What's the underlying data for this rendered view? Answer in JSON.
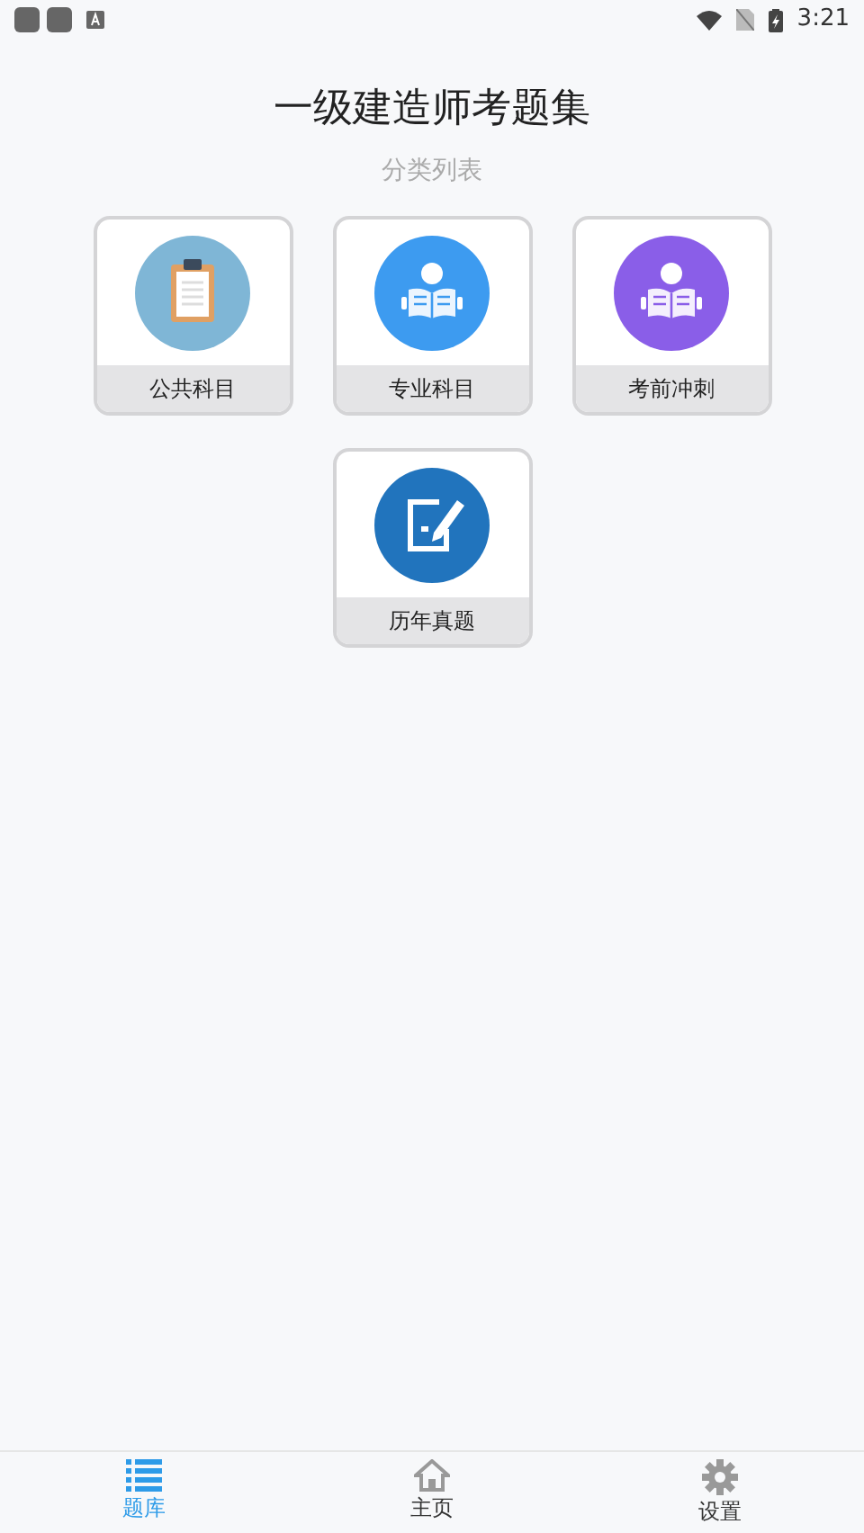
{
  "status_bar": {
    "time": "3:21"
  },
  "header": {
    "title": "一级建造师考题集",
    "subtitle": "分类列表"
  },
  "categories": [
    {
      "label": "公共科目",
      "kind": "clipboard",
      "color": "#7fb6d6"
    },
    {
      "label": "专业科目",
      "kind": "reader",
      "color": "#3d9bf0"
    },
    {
      "label": "考前冲刺",
      "kind": "reader",
      "color": "#8a5ee8"
    },
    {
      "label": "历年真题",
      "kind": "pen",
      "color": "#2174bd"
    }
  ],
  "tab_bar": [
    {
      "label": "题库",
      "kind": "list",
      "selected": true
    },
    {
      "label": "主页",
      "kind": "home",
      "selected": false
    },
    {
      "label": "设置",
      "kind": "gear",
      "selected": false
    }
  ]
}
